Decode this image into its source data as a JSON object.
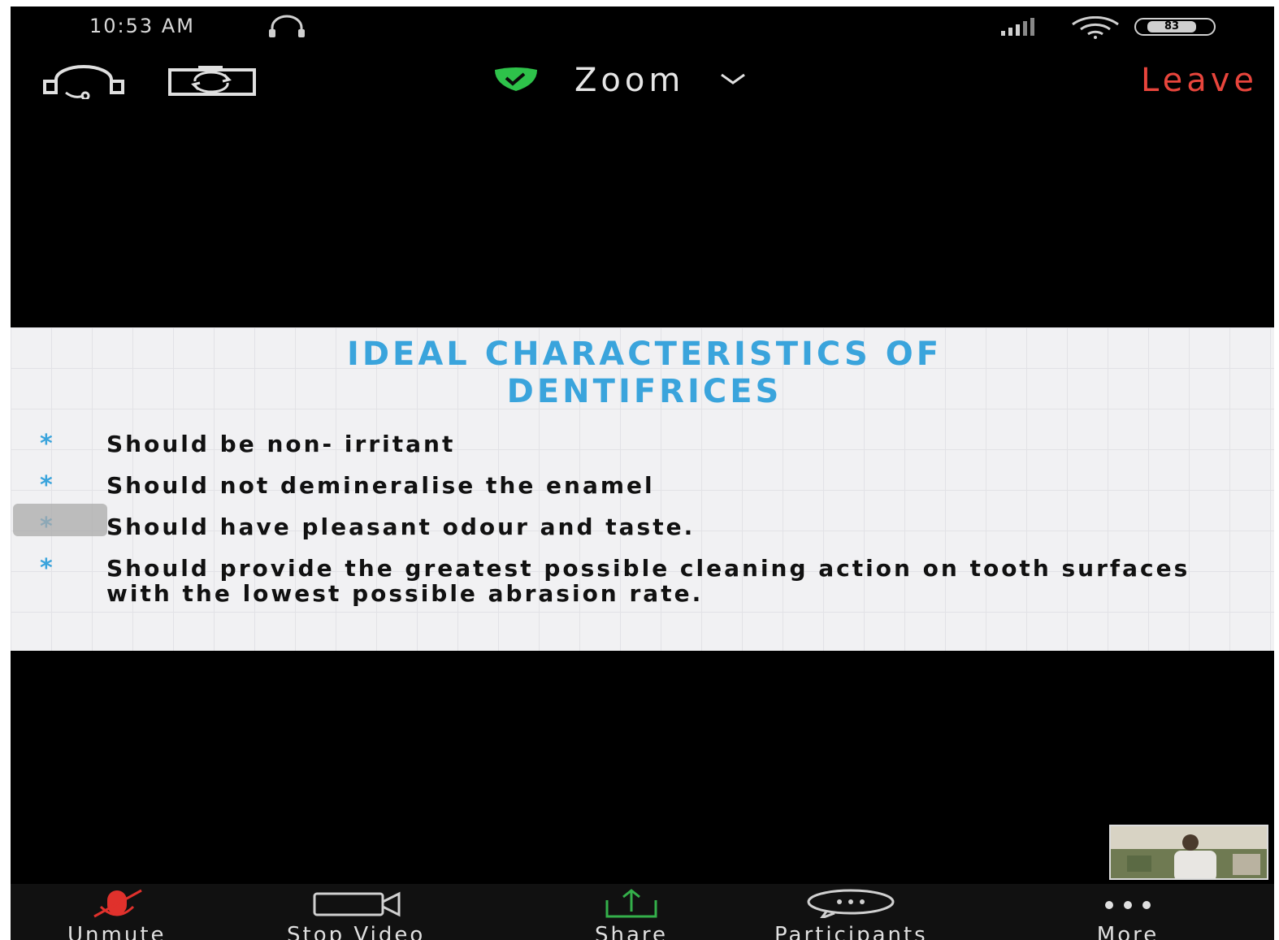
{
  "status_bar": {
    "time": "10:53 AM",
    "battery": "83"
  },
  "top_bar": {
    "meeting_name": "Zoom",
    "leave_label": "Leave",
    "icons": [
      "audio-headset-icon",
      "switch-camera-icon",
      "shield-check-icon",
      "chevron-down-icon"
    ]
  },
  "slide": {
    "title_line1": "IDEAL CHARACTERISTICS OF",
    "title_line2": "DENTIFRICES",
    "bullet_marker": "*",
    "bullets": [
      "Should be non- irritant",
      "Should not demineralise the enamel",
      "Should have pleasant odour and taste.",
      "Should provide the greatest possible cleaning action on tooth surfaces with the lowest possible abrasion rate."
    ]
  },
  "toolbar": {
    "unmute_label": "Unmute",
    "stop_video_label": "Stop Video",
    "share_label": "Share",
    "participants_label": "Participants",
    "more_label": "More"
  },
  "colors": {
    "leave": "#e8453c",
    "title_blue": "#3aa4dc",
    "shield_green": "#2ec24a",
    "share_green": "#34b04a",
    "muted_red": "#e0312c"
  }
}
